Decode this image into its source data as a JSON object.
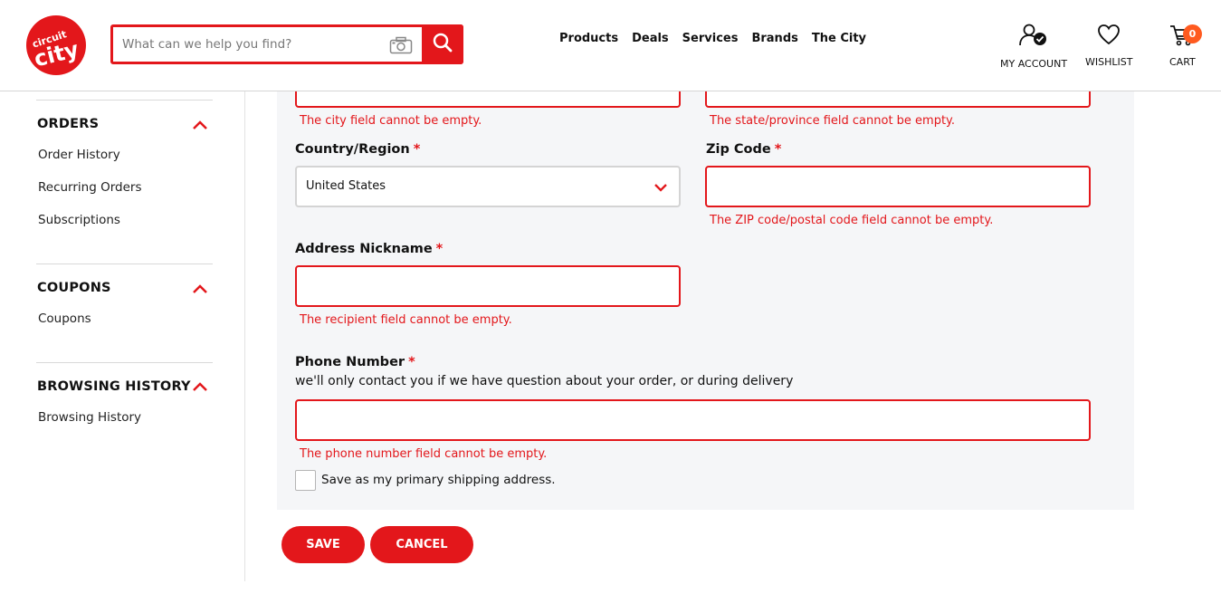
{
  "header": {
    "logo_alt": "circuit city",
    "search": {
      "placeholder": "What can we help you find?"
    },
    "nav": [
      "Products",
      "Deals",
      "Services",
      "Brands",
      "The City"
    ],
    "account_label": "MY ACCOUNT",
    "wishlist_label": "WISHLIST",
    "cart_label": "CART",
    "cart_count": "0"
  },
  "sidebar": {
    "sections": [
      {
        "title": "ORDERS",
        "links": [
          "Order History",
          "Recurring Orders",
          "Subscriptions"
        ]
      },
      {
        "title": "COUPONS",
        "links": [
          "Coupons"
        ]
      },
      {
        "title": "BROWSING HISTORY",
        "links": [
          "Browsing History"
        ]
      }
    ]
  },
  "form": {
    "city_error": "The city field cannot be empty.",
    "state_error": "The state/province field cannot be empty.",
    "country_label": "Country/Region",
    "country_value": "United States",
    "zip_label": "Zip Code",
    "zip_error": "The ZIP code/postal code field cannot be empty.",
    "nickname_label": "Address Nickname",
    "nickname_error": "The recipient field cannot be empty.",
    "phone_label": "Phone Number",
    "phone_hint": "we'll only contact you if we have question about your order, or during delivery",
    "phone_error": "The phone number field cannot be empty.",
    "primary_label": "Save as my primary shipping address.",
    "required_mark": "*"
  },
  "buttons": {
    "save": "SAVE",
    "cancel": "CANCEL"
  },
  "colors": {
    "brand_red": "#e3171b",
    "cart_badge": "#ff5a1f",
    "panel_bg": "#f5f6f8"
  }
}
